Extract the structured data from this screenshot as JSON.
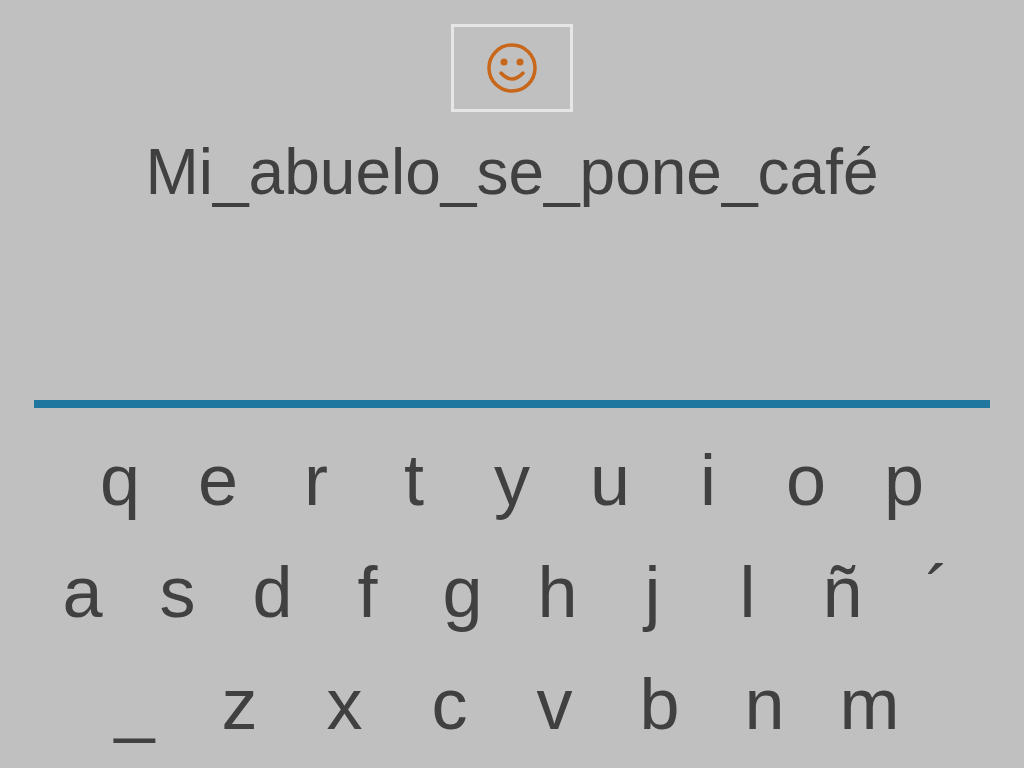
{
  "sentence": "Mi_abuelo_se_pone_café",
  "keyboard": [
    [
      "q",
      "e",
      "r",
      "t",
      "y",
      "u",
      "i",
      "o",
      "p"
    ],
    [
      "a",
      "s",
      "d",
      "f",
      "g",
      "h",
      "j",
      "l",
      "ñ",
      "´"
    ],
    [
      "_",
      "z",
      "x",
      "c",
      "v",
      "b",
      "n",
      "m"
    ]
  ]
}
